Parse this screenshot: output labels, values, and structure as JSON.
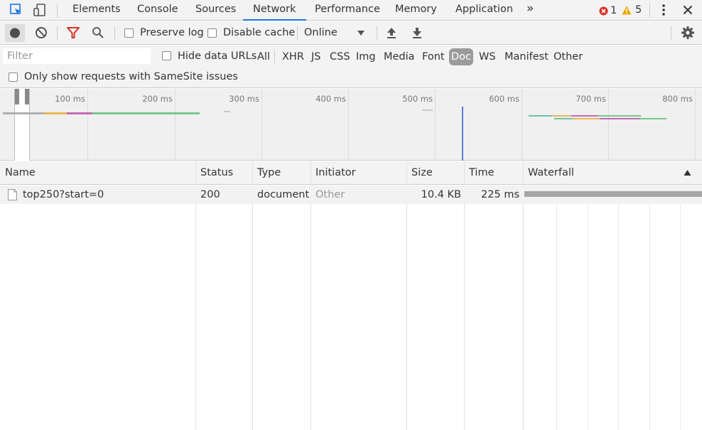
{
  "tabs": {
    "elements": "Elements",
    "console": "Console",
    "sources": "Sources",
    "network": "Network",
    "performance": "Performance",
    "memory": "Memory",
    "application": "Application",
    "more": "»"
  },
  "status": {
    "errors": "1",
    "warnings": "5"
  },
  "toolbar": {
    "preserve_log": "Preserve log",
    "disable_cache": "Disable cache",
    "throttle": "Online"
  },
  "filter": {
    "placeholder": "Filter",
    "hide_data_urls": "Hide data URLs",
    "types": [
      "All",
      "XHR",
      "JS",
      "CSS",
      "Img",
      "Media",
      "Font",
      "Doc",
      "WS",
      "Manifest",
      "Other"
    ],
    "active_type": "Doc",
    "samesite": "Only show requests with SameSite issues"
  },
  "overview": {
    "ticks": [
      "100 ms",
      "200 ms",
      "300 ms",
      "400 ms",
      "500 ms",
      "600 ms",
      "700 ms",
      "800 ms"
    ]
  },
  "table": {
    "headers": {
      "name": "Name",
      "status": "Status",
      "type": "Type",
      "initiator": "Initiator",
      "size": "Size",
      "time": "Time",
      "waterfall": "Waterfall"
    },
    "rows": [
      {
        "name": "top250?start=0",
        "status": "200",
        "type": "document",
        "initiator": "Other",
        "size": "10.4 KB",
        "time": "225 ms"
      }
    ]
  },
  "colors": {
    "accent": "#1a73e8",
    "record": "#4d4d4d",
    "filter_active": "#d93025",
    "error": "#d93025",
    "warning": "#f2a600"
  }
}
